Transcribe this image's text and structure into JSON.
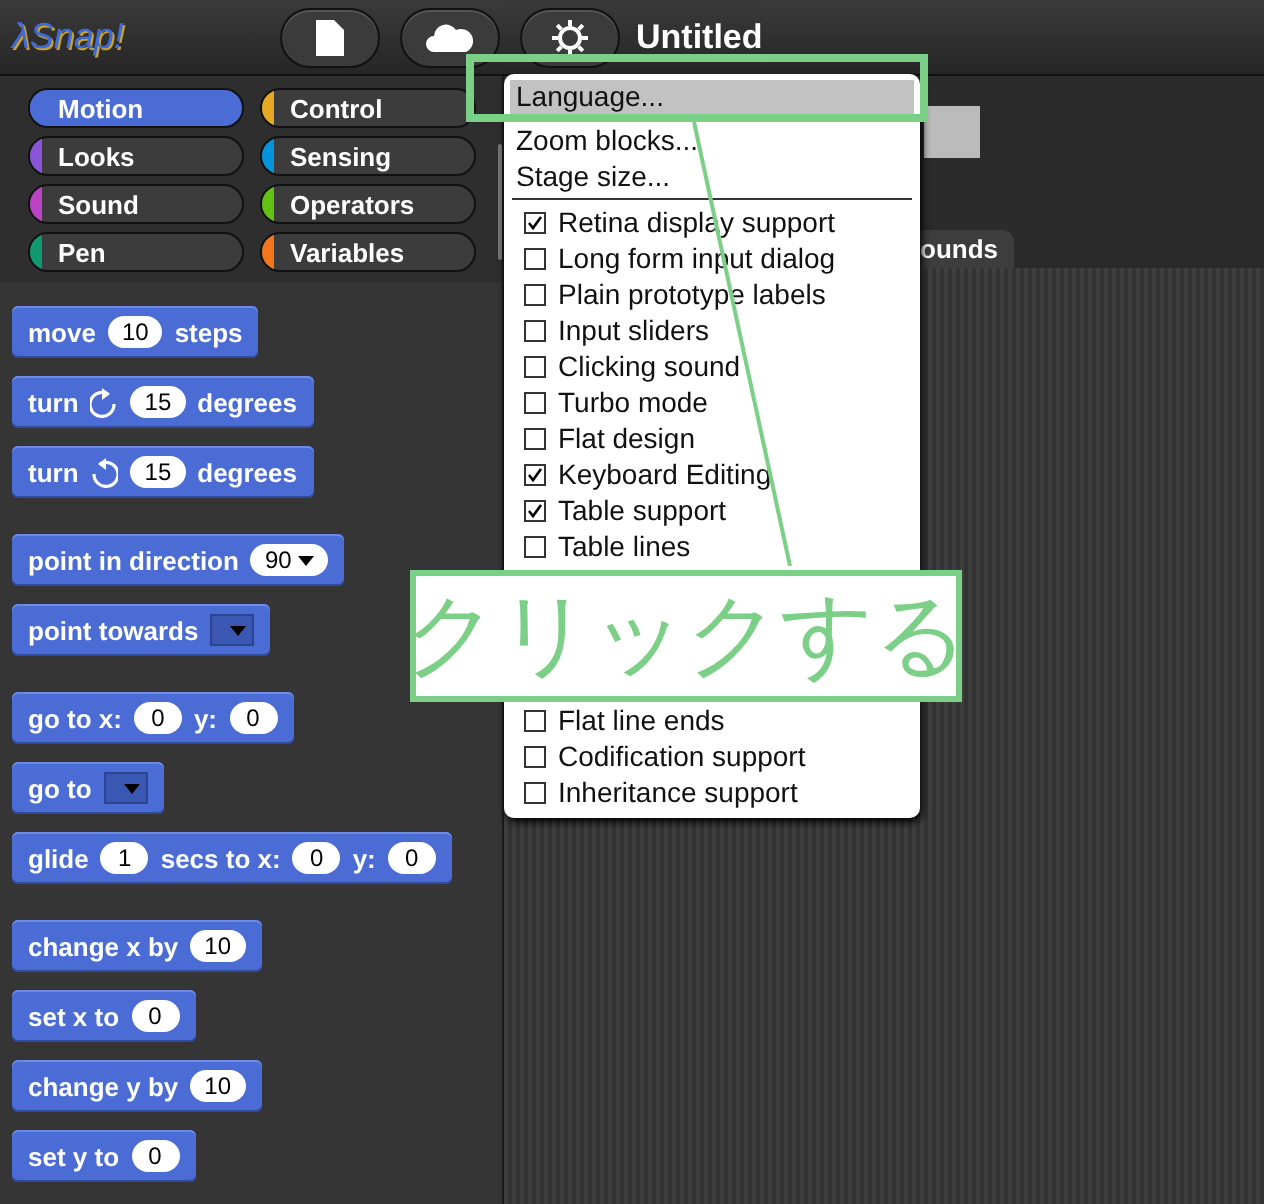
{
  "logo": "λSnap!",
  "toolbar": {
    "title": "Untitled"
  },
  "categories": [
    {
      "label": "Motion",
      "color": "#4a6cd4",
      "selected": true
    },
    {
      "label": "Control",
      "color": "#e6a822",
      "selected": false
    },
    {
      "label": "Looks",
      "color": "#8a55d7",
      "selected": false
    },
    {
      "label": "Sensing",
      "color": "#0494dc",
      "selected": false
    },
    {
      "label": "Sound",
      "color": "#bb42c3",
      "selected": false
    },
    {
      "label": "Operators",
      "color": "#62c213",
      "selected": false
    },
    {
      "label": "Pen",
      "color": "#0e9a6c",
      "selected": false
    },
    {
      "label": "Variables",
      "color": "#f3761d",
      "selected": false
    }
  ],
  "block_groups": [
    [
      {
        "parts": [
          {
            "kind": "label",
            "text": "move"
          },
          {
            "kind": "slot",
            "text": "10"
          },
          {
            "kind": "label",
            "text": "steps"
          }
        ]
      },
      {
        "parts": [
          {
            "kind": "label",
            "text": "turn"
          },
          {
            "kind": "cw"
          },
          {
            "kind": "slot",
            "text": "15"
          },
          {
            "kind": "label",
            "text": "degrees"
          }
        ]
      },
      {
        "parts": [
          {
            "kind": "label",
            "text": "turn"
          },
          {
            "kind": "ccw"
          },
          {
            "kind": "slot",
            "text": "15"
          },
          {
            "kind": "label",
            "text": "degrees"
          }
        ]
      }
    ],
    [
      {
        "parts": [
          {
            "kind": "label",
            "text": "point in direction"
          },
          {
            "kind": "menu-slot",
            "text": "90"
          }
        ]
      },
      {
        "parts": [
          {
            "kind": "label",
            "text": "point towards"
          },
          {
            "kind": "dropdown"
          }
        ]
      }
    ],
    [
      {
        "parts": [
          {
            "kind": "label",
            "text": "go to x:"
          },
          {
            "kind": "slot",
            "text": "0"
          },
          {
            "kind": "label",
            "text": "y:"
          },
          {
            "kind": "slot",
            "text": "0"
          }
        ]
      },
      {
        "parts": [
          {
            "kind": "label",
            "text": "go to"
          },
          {
            "kind": "dropdown"
          }
        ]
      },
      {
        "parts": [
          {
            "kind": "label",
            "text": "glide"
          },
          {
            "kind": "slot",
            "text": "1"
          },
          {
            "kind": "label",
            "text": "secs to x:"
          },
          {
            "kind": "slot",
            "text": "0"
          },
          {
            "kind": "label",
            "text": "y:"
          },
          {
            "kind": "slot",
            "text": "0"
          }
        ]
      }
    ],
    [
      {
        "parts": [
          {
            "kind": "label",
            "text": "change x by"
          },
          {
            "kind": "slot",
            "text": "10"
          }
        ]
      },
      {
        "parts": [
          {
            "kind": "label",
            "text": "set x to"
          },
          {
            "kind": "slot",
            "text": "0"
          }
        ]
      },
      {
        "parts": [
          {
            "kind": "label",
            "text": "change y by"
          },
          {
            "kind": "slot",
            "text": "10"
          }
        ]
      },
      {
        "parts": [
          {
            "kind": "label",
            "text": "set y to"
          },
          {
            "kind": "slot",
            "text": "0"
          }
        ]
      }
    ]
  ],
  "stage_tabs": [
    {
      "label": "ounds"
    }
  ],
  "menu": {
    "sections": [
      {
        "items": [
          {
            "kind": "action",
            "label": "Language...",
            "selected": true
          },
          {
            "kind": "action",
            "label": "Zoom blocks...",
            "selected": false
          },
          {
            "kind": "action",
            "label": "Stage size...",
            "selected": false
          }
        ]
      },
      {
        "items": [
          {
            "kind": "toggle",
            "label": "Retina display support",
            "checked": true,
            "selected": false
          },
          {
            "kind": "toggle",
            "label": "Long form input dialog",
            "checked": false,
            "selected": false
          },
          {
            "kind": "toggle",
            "label": "Plain prototype labels",
            "checked": false,
            "selected": false
          },
          {
            "kind": "toggle",
            "label": "Input sliders",
            "checked": false,
            "selected": false
          },
          {
            "kind": "toggle",
            "label": "Clicking sound",
            "checked": false,
            "selected": false
          },
          {
            "kind": "toggle",
            "label": "Turbo mode",
            "checked": false,
            "selected": false
          },
          {
            "kind": "toggle",
            "label": "Flat design",
            "checked": false,
            "selected": false
          },
          {
            "kind": "toggle",
            "label": "Keyboard Editing",
            "checked": true,
            "selected": false
          },
          {
            "kind": "toggle",
            "label": "Table support",
            "checked": true,
            "selected": false
          },
          {
            "kind": "toggle",
            "label": "Table lines",
            "checked": false,
            "selected": false
          },
          {
            "kind": "callout",
            "text": "クリックする"
          },
          {
            "kind": "toggle",
            "label": "Flat line ends",
            "checked": false,
            "selected": false
          },
          {
            "kind": "toggle",
            "label": "Codification support",
            "checked": false,
            "selected": false
          },
          {
            "kind": "toggle",
            "label": "Inheritance support",
            "checked": false,
            "selected": false
          }
        ]
      }
    ]
  }
}
